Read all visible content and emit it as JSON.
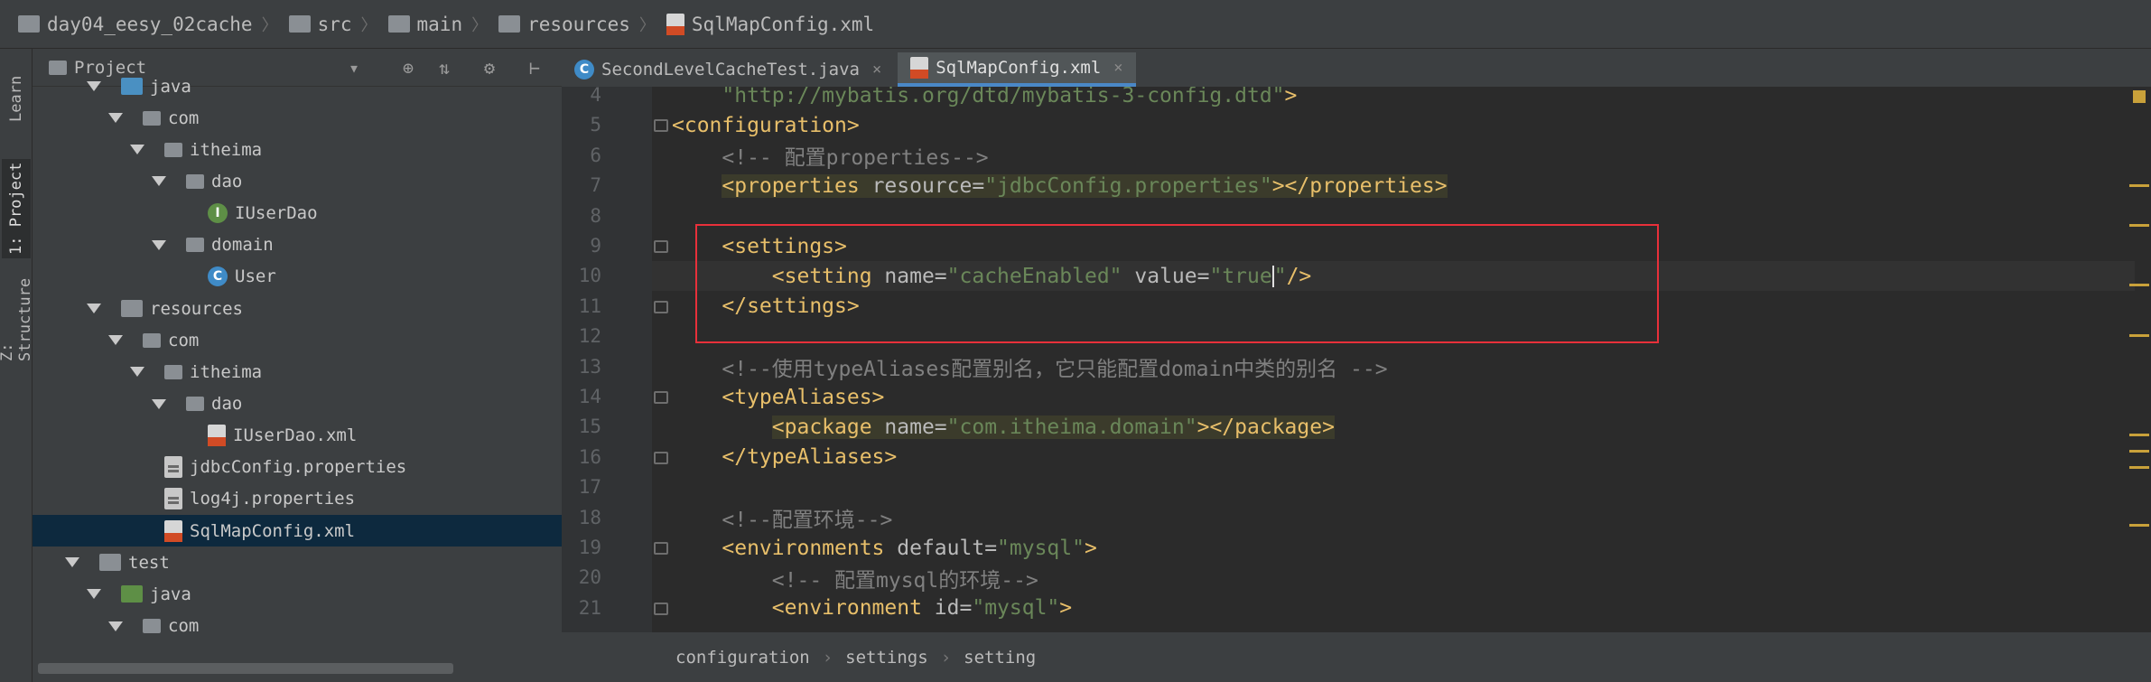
{
  "breadcrumb": [
    {
      "label": "day04_eesy_02cache",
      "icon": "module-folder-icon"
    },
    {
      "label": "src",
      "icon": "folder-icon"
    },
    {
      "label": "main",
      "icon": "folder-icon"
    },
    {
      "label": "resources",
      "icon": "resources-folder-icon"
    },
    {
      "label": "SqlMapConfig.xml",
      "icon": "xml-file-icon"
    }
  ],
  "side_tabs": {
    "learn": "Learn",
    "project": "1: Project",
    "structure": "Z: Structure"
  },
  "project_panel": {
    "title": "Project",
    "tree": [
      {
        "label": "java",
        "type": "folder-blue",
        "expanded": true
      },
      {
        "label": "com",
        "type": "package",
        "expanded": true
      },
      {
        "label": "itheima",
        "type": "package",
        "expanded": true
      },
      {
        "label": "dao",
        "type": "package",
        "expanded": true
      },
      {
        "label": "IUserDao",
        "type": "interface"
      },
      {
        "label": "domain",
        "type": "package",
        "expanded": true
      },
      {
        "label": "User",
        "type": "class"
      },
      {
        "label": "resources",
        "type": "resources",
        "expanded": true
      },
      {
        "label": "com",
        "type": "package",
        "expanded": true
      },
      {
        "label": "itheima",
        "type": "package",
        "expanded": true
      },
      {
        "label": "dao",
        "type": "package",
        "expanded": true
      },
      {
        "label": "IUserDao.xml",
        "type": "xml"
      },
      {
        "label": "jdbcConfig.properties",
        "type": "properties"
      },
      {
        "label": "log4j.properties",
        "type": "properties"
      },
      {
        "label": "SqlMapConfig.xml",
        "type": "xml",
        "selected": true
      },
      {
        "label": "test",
        "type": "folder",
        "expanded": true
      },
      {
        "label": "java",
        "type": "folder-green",
        "expanded": true
      },
      {
        "label": "com",
        "type": "package",
        "expanded": true
      }
    ]
  },
  "tabs": [
    {
      "label": "SecondLevelCacheTest.java",
      "active": false
    },
    {
      "label": "SqlMapConfig.xml",
      "active": true
    }
  ],
  "editor": {
    "lines": [
      {
        "n": "4",
        "segs": [
          [
            "    ",
            ""
          ],
          [
            "\"http://mybatis.org/dtd/mybatis-3-config.dtd\"",
            "av"
          ],
          [
            ">",
            "tag"
          ]
        ]
      },
      {
        "n": "5",
        "segs": [
          [
            "<configuration>",
            "tag"
          ]
        ]
      },
      {
        "n": "6",
        "segs": [
          [
            "    ",
            ""
          ],
          [
            "<!-- 配置properties-->",
            "cm"
          ]
        ]
      },
      {
        "n": "7",
        "segs": [
          [
            "    ",
            ""
          ],
          [
            "<properties ",
            "tag hl"
          ],
          [
            "resource=",
            "an hl"
          ],
          [
            "\"jdbcConfig.properties\"",
            "av hl"
          ],
          [
            "></properties>",
            "tag hl"
          ]
        ]
      },
      {
        "n": "8",
        "segs": []
      },
      {
        "n": "9",
        "segs": [
          [
            "    ",
            ""
          ],
          [
            "<settings>",
            "tag"
          ]
        ]
      },
      {
        "n": "10",
        "segs": [
          [
            "        ",
            ""
          ],
          [
            "<setting ",
            "tag"
          ],
          [
            "name=",
            "an"
          ],
          [
            "\"cacheEnabled\" ",
            "av"
          ],
          [
            "value=",
            "an"
          ],
          [
            "\"true",
            "av"
          ],
          [
            "|caret|",
            ""
          ],
          [
            "\"",
            "av"
          ],
          [
            "/>",
            "tag"
          ]
        ]
      },
      {
        "n": "11",
        "segs": [
          [
            "    ",
            ""
          ],
          [
            "</settings>",
            "tag"
          ]
        ]
      },
      {
        "n": "12",
        "segs": []
      },
      {
        "n": "13",
        "segs": [
          [
            "    ",
            ""
          ],
          [
            "<!--使用typeAliases配置别名，它只能配置domain中类的别名 -->",
            "cm"
          ]
        ]
      },
      {
        "n": "14",
        "segs": [
          [
            "    ",
            ""
          ],
          [
            "<typeAliases>",
            "tag"
          ]
        ]
      },
      {
        "n": "15",
        "segs": [
          [
            "        ",
            ""
          ],
          [
            "<package ",
            "tag hl"
          ],
          [
            "name=",
            "an hl"
          ],
          [
            "\"com.itheima.domain\"",
            "av hl"
          ],
          [
            "></package>",
            "tag hl"
          ]
        ]
      },
      {
        "n": "16",
        "segs": [
          [
            "    ",
            ""
          ],
          [
            "</typeAliases>",
            "tag"
          ]
        ]
      },
      {
        "n": "17",
        "segs": []
      },
      {
        "n": "18",
        "segs": [
          [
            "    ",
            ""
          ],
          [
            "<!--配置环境-->",
            "cm"
          ]
        ]
      },
      {
        "n": "19",
        "segs": [
          [
            "    ",
            ""
          ],
          [
            "<environments ",
            "tag"
          ],
          [
            "default=",
            "an"
          ],
          [
            "\"mysql\"",
            "av"
          ],
          [
            ">",
            "tag"
          ]
        ]
      },
      {
        "n": "20",
        "segs": [
          [
            "        ",
            ""
          ],
          [
            "<!-- 配置mysql的环境-->",
            "cm"
          ]
        ]
      },
      {
        "n": "21",
        "segs": [
          [
            "        ",
            ""
          ],
          [
            "<environment ",
            "tag"
          ],
          [
            "id=",
            "an"
          ],
          [
            "\"mysql\"",
            "av"
          ],
          [
            ">",
            "tag"
          ]
        ]
      }
    ]
  },
  "status_breadcrumb": [
    "configuration",
    "settings",
    "setting"
  ],
  "browsers": [
    "chrome-icon",
    "firefox-icon",
    "safari-icon",
    "opera-icon",
    "ie-icon"
  ],
  "colors": {
    "accent": "#4a88c7",
    "highlight_box": "#e8303a",
    "selection": "#0d293e"
  }
}
